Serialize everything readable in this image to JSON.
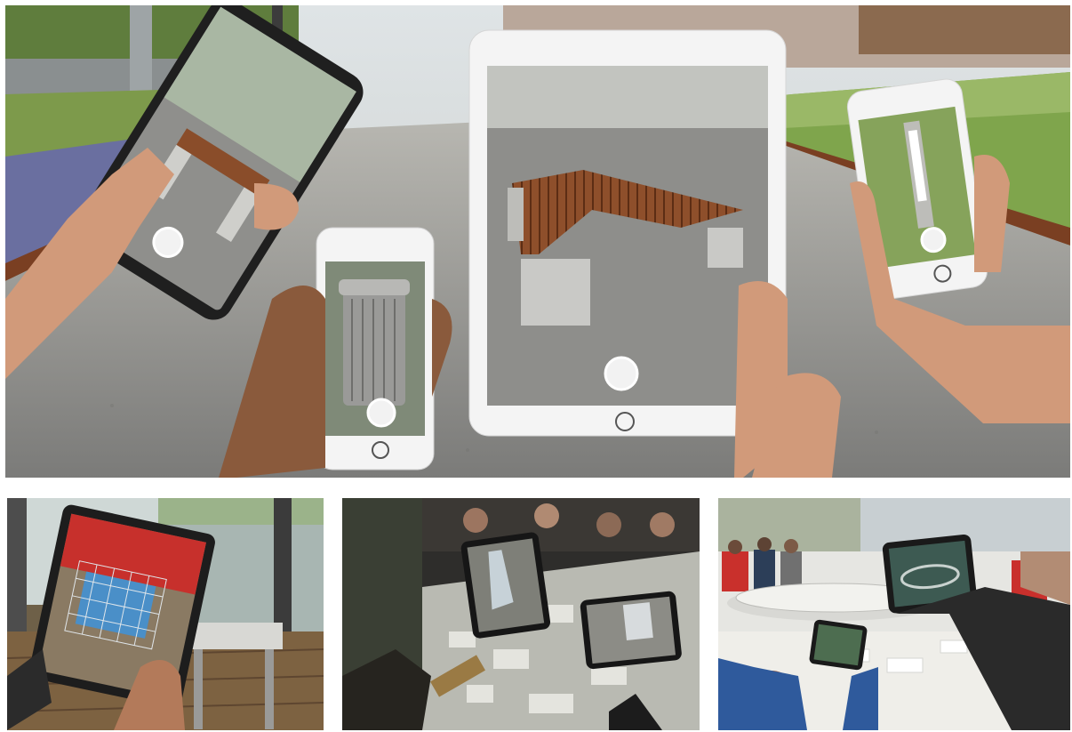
{
  "scene": {
    "description_free": true
  },
  "panels": {
    "hero": {
      "devices": [
        {
          "type": "android-phone",
          "content": "bench"
        },
        {
          "type": "iphone",
          "content": "trash-bin"
        },
        {
          "type": "ipad",
          "content": "tri-bench"
        },
        {
          "type": "iphone",
          "content": "bollard"
        }
      ]
    },
    "bottom": [
      {
        "id": "window-tablet",
        "content": "blue-cube-model"
      },
      {
        "id": "city-model-table",
        "content": "city-model"
      },
      {
        "id": "museum-tablets",
        "content": "circular-building-model"
      }
    ]
  },
  "colors": {
    "pavement": "#8d8d8b",
    "grass": "#7fa54c",
    "wood": "#8a4d2a",
    "concrete": "#c9c9c6",
    "skin": "#d19a7a",
    "dark-skin": "#8a5a3c",
    "device-white": "#f4f4f4",
    "device-black": "#222222"
  }
}
